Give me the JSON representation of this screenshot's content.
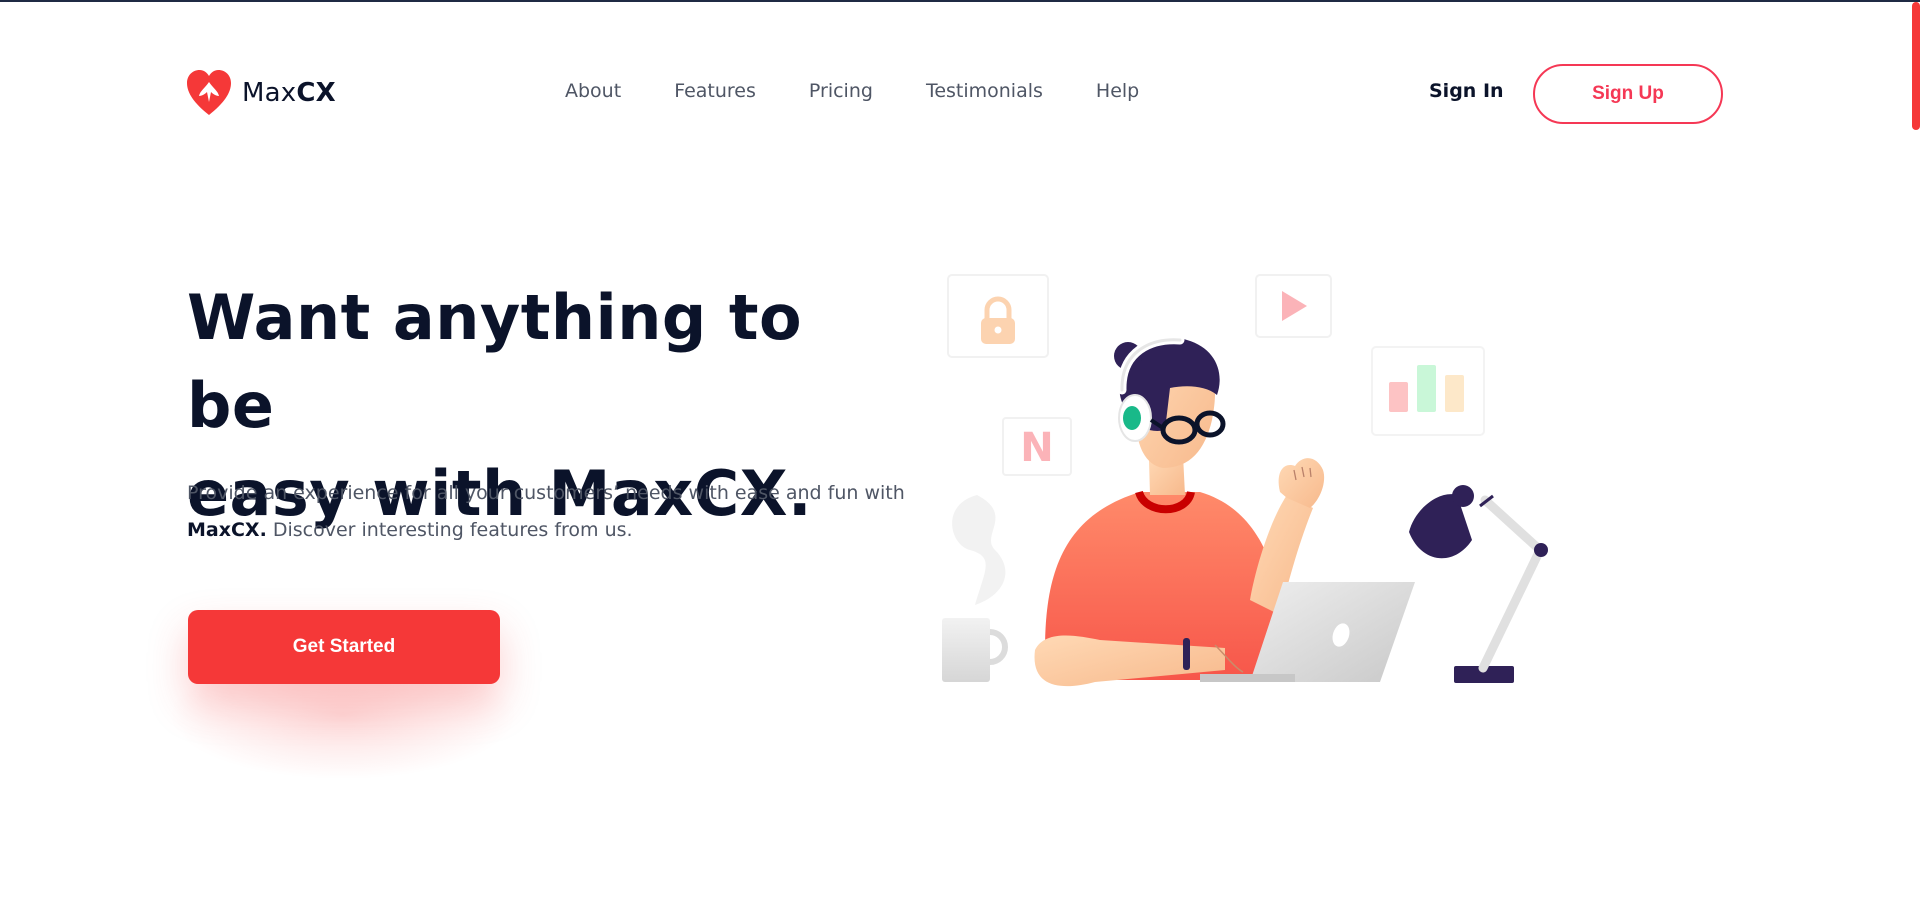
{
  "brand": {
    "name_light": "Max",
    "name_bold": "CX",
    "logo_icon": "heart-logo-icon",
    "accent": "#f53838"
  },
  "nav": {
    "links": [
      "About",
      "Features",
      "Pricing",
      "Testimonials",
      "Help"
    ],
    "sign_in": "Sign In",
    "sign_up": "Sign Up"
  },
  "hero": {
    "title_line1": "Want anything to be",
    "title_line2_prefix": "easy with Max",
    "title_line2_bold": "CX",
    "title_line2_suffix": ".",
    "desc_prefix": "Provide an experience for all your customers’ needs with ease and fun with ",
    "desc_bold": "MaxCX.",
    "desc_suffix": " Discover interesting features from us.",
    "cta": "Get Started"
  },
  "illustration": {
    "badges": {
      "netflix_letter": "N"
    },
    "icons": [
      "lock-icon",
      "play-icon",
      "bar-chart-icon",
      "netflix-icon",
      "mug-icon",
      "desk-lamp-icon",
      "laptop-icon"
    ]
  }
}
